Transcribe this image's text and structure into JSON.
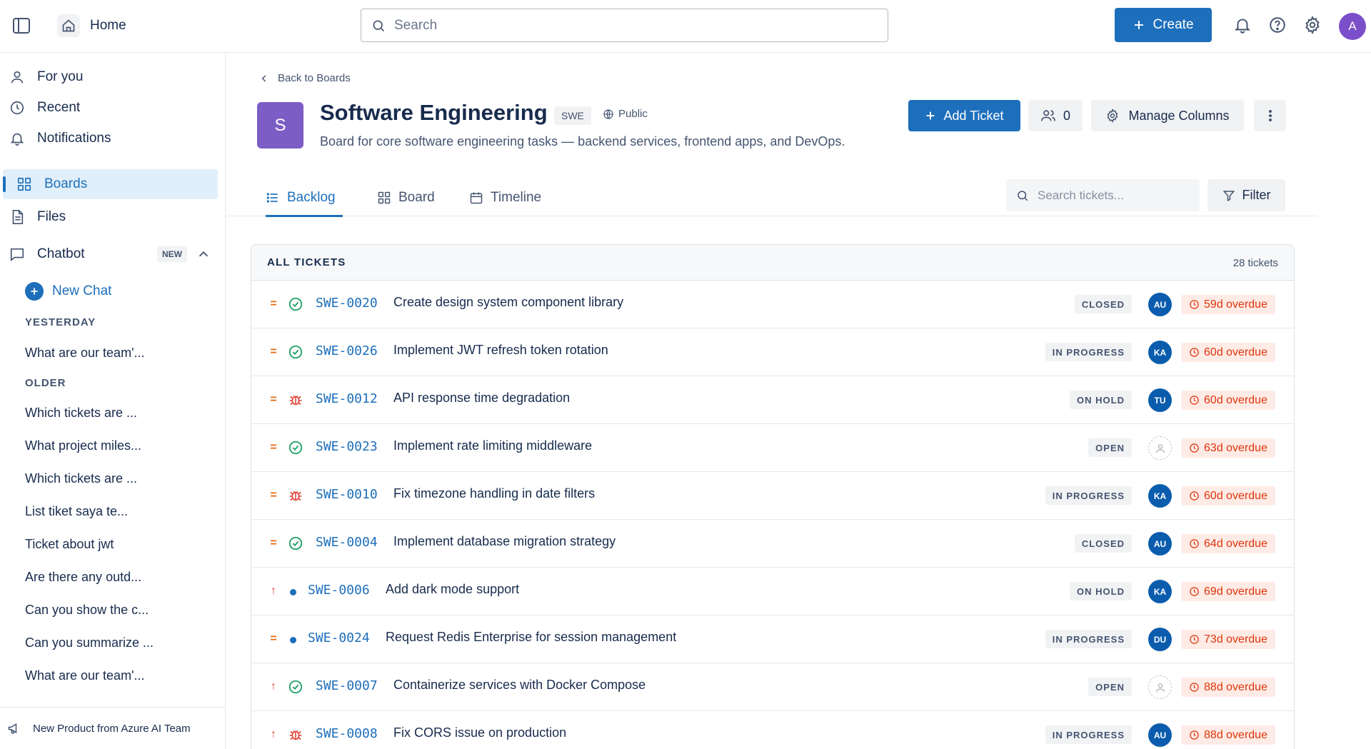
{
  "topbar": {
    "home_label": "Home",
    "search_placeholder": "Search",
    "create_label": "Create",
    "avatar_initial": "A"
  },
  "sidebar": {
    "nav": [
      {
        "label": "For you",
        "icon": "user-icon"
      },
      {
        "label": "Recent",
        "icon": "clock-icon"
      },
      {
        "label": "Notifications",
        "icon": "bell-icon"
      },
      {
        "label": "Boards",
        "icon": "grid-icon",
        "active": true
      },
      {
        "label": "Files",
        "icon": "file-icon"
      },
      {
        "label": "Chatbot",
        "icon": "chat-icon",
        "badge": "NEW"
      }
    ],
    "new_chat_label": "New Chat",
    "section_yesterday": "YESTERDAY",
    "section_older": "OLDER",
    "chats_yesterday": [
      "What are our team'..."
    ],
    "chats_older": [
      "Which tickets are ...",
      "What project miles...",
      "Which tickets are ...",
      "List tiket saya te...",
      "Ticket about jwt",
      "Are there any outd...",
      "Can you show the c...",
      "Can you summarize ...",
      "What are our team'..."
    ],
    "footer_label": "New Product from Azure AI Team"
  },
  "board": {
    "back_label": "Back to Boards",
    "avatar_letter": "S",
    "title": "Software Engineering",
    "key": "SWE",
    "visibility": "Public",
    "description": "Board for core software engineering tasks — backend services, frontend apps, and DevOps.",
    "add_ticket_label": "Add Ticket",
    "members_count": "0",
    "manage_columns_label": "Manage Columns"
  },
  "tabs": [
    {
      "label": "Backlog",
      "icon": "list-icon",
      "active": true
    },
    {
      "label": "Board",
      "icon": "board-icon"
    },
    {
      "label": "Timeline",
      "icon": "calendar-icon"
    }
  ],
  "ticket_search_placeholder": "Search tickets...",
  "filter_label": "Filter",
  "panel": {
    "title": "ALL TICKETS",
    "count": "28 tickets"
  },
  "tickets": [
    {
      "priority": "=",
      "type": "task",
      "key": "SWE-0020",
      "title": "Create design system component library",
      "status": "CLOSED",
      "assignee": "AU",
      "due": "59d overdue"
    },
    {
      "priority": "=",
      "type": "task",
      "key": "SWE-0026",
      "title": "Implement JWT refresh token rotation",
      "status": "IN PROGRESS",
      "assignee": "KA",
      "due": "60d overdue"
    },
    {
      "priority": "=",
      "type": "bug",
      "key": "SWE-0012",
      "title": "API response time degradation",
      "status": "ON HOLD",
      "assignee": "TU",
      "due": "60d overdue"
    },
    {
      "priority": "=",
      "type": "task",
      "key": "SWE-0023",
      "title": "Implement rate limiting middleware",
      "status": "OPEN",
      "assignee": "",
      "due": "63d overdue"
    },
    {
      "priority": "=",
      "type": "bug",
      "key": "SWE-0010",
      "title": "Fix timezone handling in date filters",
      "status": "IN PROGRESS",
      "assignee": "KA",
      "due": "60d overdue"
    },
    {
      "priority": "=",
      "type": "task",
      "key": "SWE-0004",
      "title": "Implement database migration strategy",
      "status": "CLOSED",
      "assignee": "AU",
      "due": "64d overdue"
    },
    {
      "priority": "↑",
      "type": "story",
      "key": "SWE-0006",
      "title": "Add dark mode support",
      "status": "ON HOLD",
      "assignee": "KA",
      "due": "69d overdue"
    },
    {
      "priority": "=",
      "type": "story",
      "key": "SWE-0024",
      "title": "Request Redis Enterprise for session management",
      "status": "IN PROGRESS",
      "assignee": "DU",
      "due": "73d overdue"
    },
    {
      "priority": "↑",
      "type": "task",
      "key": "SWE-0007",
      "title": "Containerize services with Docker Compose",
      "status": "OPEN",
      "assignee": "",
      "due": "88d overdue"
    },
    {
      "priority": "↑",
      "type": "bug",
      "key": "SWE-0008",
      "title": "Fix CORS issue on production",
      "status": "IN PROGRESS",
      "assignee": "AU",
      "due": "88d overdue"
    }
  ],
  "colors": {
    "accent": "#1d6fbb",
    "board_avatar": "#7c5cc5",
    "overdue_text": "#de350b",
    "overdue_bg": "#ffebe6",
    "task_icon": "#22a06b",
    "bug_icon": "#e2483d",
    "priority_medium": "#e56910",
    "priority_high": "#e2483d"
  }
}
